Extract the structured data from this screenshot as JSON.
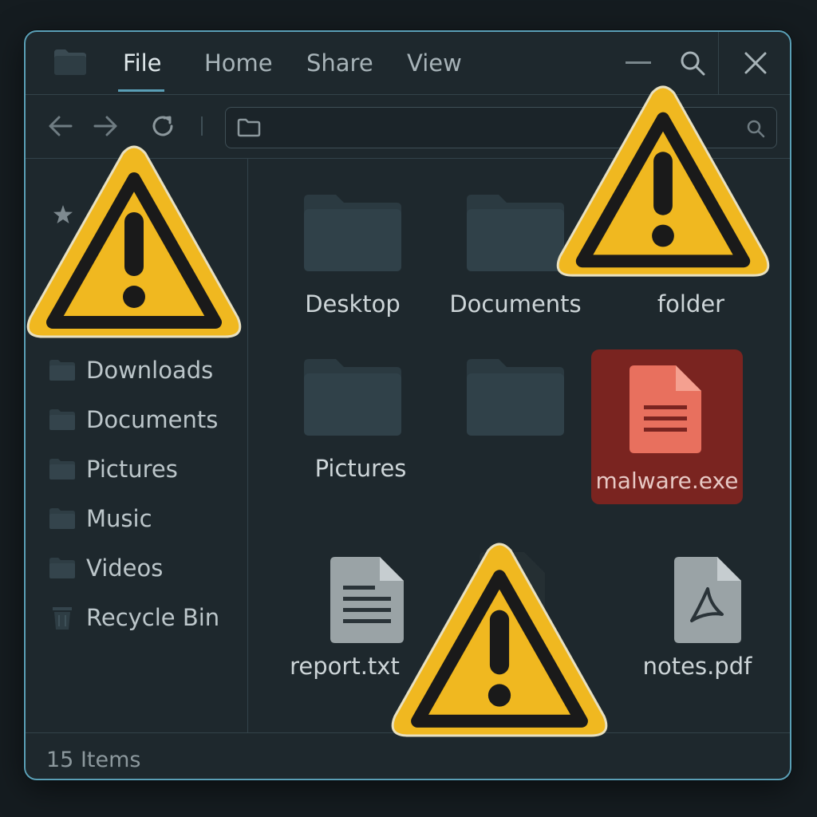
{
  "menu": {
    "file": "File",
    "home": "Home",
    "share": "Share",
    "view": "View"
  },
  "sidebar": {
    "items": [
      {
        "label": "Downloads",
        "icon": "folder-icon"
      },
      {
        "label": "Documents",
        "icon": "folder-icon"
      },
      {
        "label": "Pictures",
        "icon": "folder-icon"
      },
      {
        "label": "Music",
        "icon": "folder-icon"
      },
      {
        "label": "Videos",
        "icon": "folder-icon"
      },
      {
        "label": "Recycle Bin",
        "icon": "recycle-bin-icon"
      }
    ]
  },
  "files": [
    {
      "name": "Desktop",
      "type": "folder"
    },
    {
      "name": "Documents",
      "type": "folder"
    },
    {
      "name": "folder",
      "type": "folder"
    },
    {
      "name": "Pictures",
      "type": "folder"
    },
    {
      "name": "",
      "type": "folder"
    },
    {
      "name": "malware.exe",
      "type": "malware-file"
    },
    {
      "name": "report.txt",
      "type": "text-file"
    },
    {
      "name": "",
      "type": "file"
    },
    {
      "name": "notes.pdf",
      "type": "pdf-file"
    }
  ],
  "status": {
    "count": "15 Items"
  },
  "colors": {
    "accent": "#5a9fb6",
    "warning": "#f0b820",
    "danger": "#7a2420",
    "background": "#1e282d"
  }
}
